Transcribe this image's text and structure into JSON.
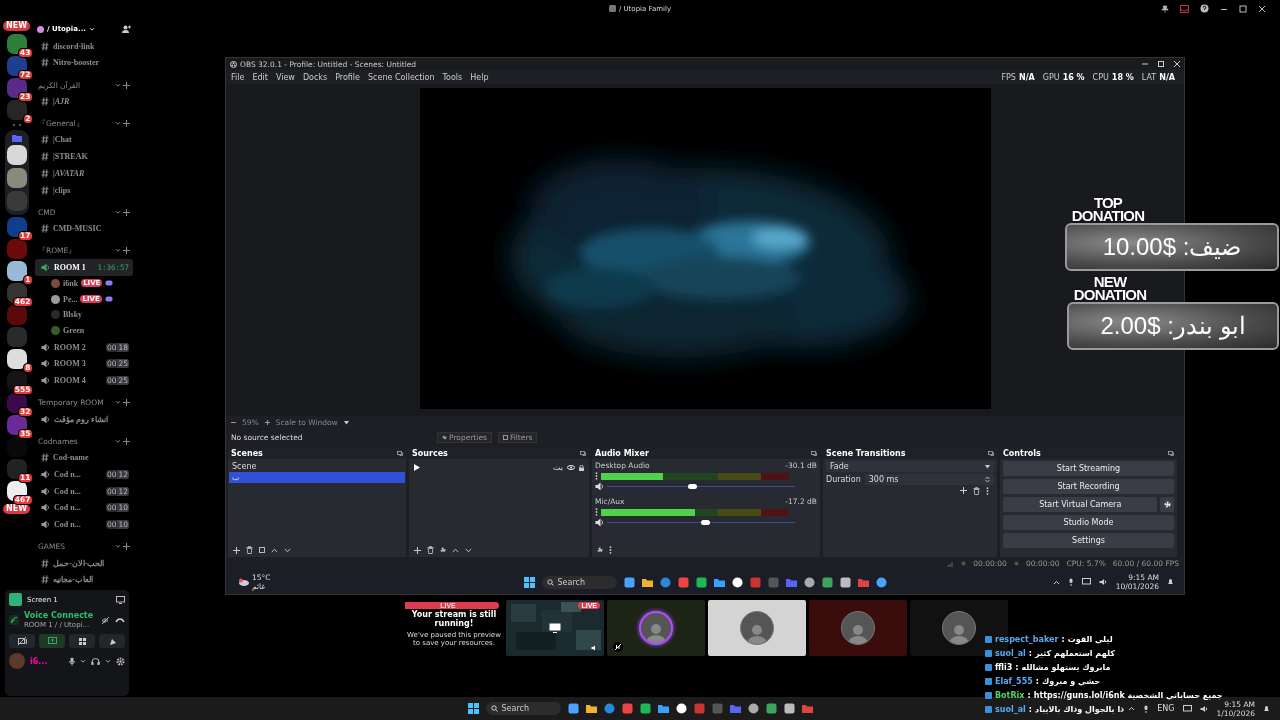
{
  "title_bar": {
    "title": "/ Utopia Family"
  },
  "servers": [
    {
      "kind": "new",
      "label": "NEW"
    },
    {
      "kind": "server",
      "color": "#2f7d3a",
      "badge": "43"
    },
    {
      "kind": "server",
      "color": "#1d3f8f",
      "badge": "72"
    },
    {
      "kind": "server",
      "color": "#5a2a8a",
      "badge": "23"
    },
    {
      "kind": "server",
      "color": "#262626",
      "badge": "2"
    },
    {
      "kind": "more"
    },
    {
      "kind": "folder",
      "children": [
        {
          "kind": "server",
          "color": "#d8d8d8"
        },
        {
          "kind": "server",
          "color": "#8a8a7a"
        },
        {
          "kind": "server",
          "color": "#3a3a3a"
        }
      ]
    },
    {
      "kind": "server",
      "color": "#0f3f8a",
      "badge": "17"
    },
    {
      "kind": "server",
      "color": "#6a0a0a"
    },
    {
      "kind": "server",
      "color": "#9ab8d8",
      "badge": "1"
    },
    {
      "kind": "server",
      "color": "#333333",
      "badge": "462"
    },
    {
      "kind": "server",
      "color": "#5a0808"
    },
    {
      "kind": "server",
      "color": "#2a2a2a"
    },
    {
      "kind": "server",
      "color": "#dddddd",
      "badge": "8"
    },
    {
      "kind": "server",
      "color": "#151515",
      "badge": "555"
    },
    {
      "kind": "server",
      "color": "#3a0a4a",
      "badge": "32"
    },
    {
      "kind": "server",
      "color": "#6a2a9a",
      "badge": "35"
    },
    {
      "kind": "server",
      "color": "#0a0a0a"
    },
    {
      "kind": "server",
      "color": "#222222",
      "badge": "11"
    },
    {
      "kind": "server",
      "color": "#eeeeee",
      "badge": "467"
    },
    {
      "kind": "new",
      "label": "NEW"
    }
  ],
  "guild": {
    "name": "/ Utopia..."
  },
  "sections": [
    {
      "items": [
        {
          "kind": "text",
          "name": "discord-link"
        },
        {
          "kind": "text",
          "name": "Nitro-booster"
        }
      ]
    },
    {
      "name": "القرآن الكريم",
      "items": [
        {
          "kind": "text",
          "name": "|AJR",
          "italic": true
        }
      ]
    },
    {
      "name": "『General』",
      "items": [
        {
          "kind": "text",
          "name": "|Chat"
        },
        {
          "kind": "text",
          "name": "|STREAK"
        },
        {
          "kind": "text",
          "name": "|AVATAR",
          "italic": true
        },
        {
          "kind": "text",
          "name": "|clips"
        }
      ]
    },
    {
      "name": "CMD",
      "items": [
        {
          "kind": "text",
          "name": "CMD-MUSIC"
        }
      ]
    },
    {
      "name": "『ROME』",
      "items": [
        {
          "kind": "voice",
          "name": "ROOM 1",
          "active": true,
          "timer": "1:36:57",
          "members": [
            {
              "name": "i6nk",
              "badge": "LIVE",
              "color": "#7a4a3a"
            },
            {
              "name": "Pe...",
              "badge": "LIVE",
              "color": "#9a9a9a"
            },
            {
              "name": "Blsky",
              "color": "#2a2a2a"
            },
            {
              "name": "Green",
              "color": "#3a5a2a"
            }
          ]
        },
        {
          "kind": "voice",
          "name": "ROOM 2",
          "active": false,
          "counts": [
            "00",
            "18"
          ]
        },
        {
          "kind": "voice",
          "name": "ROOM 3",
          "active": false,
          "counts": [
            "00",
            "25"
          ]
        },
        {
          "kind": "voice",
          "name": "ROOM 4",
          "active": false,
          "counts": [
            "00",
            "25"
          ]
        }
      ]
    },
    {
      "name": "Temporary ROOM",
      "items": [
        {
          "kind": "voice",
          "name": "انشاء روم مؤقت",
          "active": false
        }
      ]
    },
    {
      "name": "Codnames",
      "items": [
        {
          "kind": "text",
          "name": "Cod-name"
        },
        {
          "kind": "voice",
          "name": "Cod n...",
          "active": false,
          "counts": [
            "00",
            "12"
          ]
        },
        {
          "kind": "voice",
          "name": "Cod n...",
          "active": false,
          "counts": [
            "00",
            "12"
          ]
        },
        {
          "kind": "voice",
          "name": "Cod n...",
          "active": false,
          "counts": [
            "00",
            "10"
          ]
        },
        {
          "kind": "voice",
          "name": "Cod n...",
          "active": false,
          "counts": [
            "00",
            "10"
          ]
        }
      ]
    },
    {
      "name": "GAMES",
      "items": [
        {
          "kind": "text",
          "name": "الحب-الان-حمل"
        },
        {
          "kind": "text",
          "name": "العاب-مجانيه"
        }
      ]
    }
  ],
  "user_panel": {
    "stream": "Screen 1",
    "voice_status": "Voice Connecte",
    "voice_channel": "ROOM 1 / / Utopi...",
    "user": "i6..."
  },
  "obs": {
    "title": "OBS 32.0.1 - Profile: Untitled - Scenes: Untitled",
    "menu": [
      "File",
      "Edit",
      "View",
      "Docks",
      "Profile",
      "Scene Collection",
      "Tools",
      "Help"
    ],
    "stats": [
      {
        "label": "FPS",
        "value": "N/A"
      },
      {
        "label": "GPU",
        "value": "16 %"
      },
      {
        "label": "CPU",
        "value": "18 %"
      },
      {
        "label": "LAT",
        "value": "N/A"
      }
    ],
    "zoom": "59%",
    "scale": "Scale to Window",
    "source_status": "No source selected",
    "source_buttons": [
      "Properties",
      "Filters"
    ],
    "scenes": {
      "title": "Scenes",
      "items": [
        {
          "name": "Scene",
          "selected": false
        },
        {
          "name": "ب",
          "selected": true
        }
      ]
    },
    "sources": {
      "title": "Sources",
      "items": [
        {
          "name": "بث"
        }
      ]
    },
    "audio": {
      "title": "Audio Mixer",
      "channels": [
        {
          "name": "Desktop Audio",
          "reading": "-30.1 dB",
          "meter": {
            "level": 0.33
          },
          "fader": {
            "level": 0.45
          }
        },
        {
          "name": "Mic/Aux",
          "reading": "-17.2 dB",
          "meter": {
            "level": 0.5
          },
          "fader": {
            "level": 0.52
          }
        }
      ]
    },
    "transitions": {
      "title": "Scene Transitions",
      "type": "Fade",
      "duration_label": "Duration",
      "duration": "300 ms"
    },
    "controls": {
      "title": "Controls",
      "buttons": [
        "Start Streaming",
        "Start Recording",
        "Start Virtual Camera",
        "Studio Mode",
        "Settings"
      ]
    },
    "status": {
      "stream_time": "00:00:00",
      "record_time": "00:00:00",
      "cpu": "CPU: 5.7%",
      "fps": "60.00 / 60.00 FPS"
    },
    "taskbar": {
      "temp": "15°C",
      "condition": "غائم",
      "search": "Search",
      "time": "9:15 AM",
      "date": "10/01/2026"
    }
  },
  "donations": [
    {
      "title": "TOP DONATION",
      "text": "ضيف: $10.00"
    },
    {
      "title": "NEW DONATION",
      "text": "ابو بندر: $2.00"
    }
  ],
  "tiles": [
    {
      "kind": "notice",
      "title": "Your stream is still running!",
      "text": "We've paused this preview to save your resources.",
      "badge": "LIVE"
    },
    {
      "kind": "screen",
      "badge": "LIVE"
    },
    {
      "kind": "user",
      "color": "#1c2416",
      "ring": true,
      "muted": true
    },
    {
      "kind": "user",
      "color": "#d4d4d4",
      "ring": false,
      "muted": false
    },
    {
      "kind": "user",
      "color": "#3a0c0c",
      "ring": false,
      "muted": false
    },
    {
      "kind": "user",
      "color": "#111111",
      "ring": false,
      "muted": false
    }
  ],
  "chat": [
    {
      "user": "respect_baker",
      "color": "#5aa9f0",
      "sep": ":",
      "text": "ليلي القوت"
    },
    {
      "user": "suol_al",
      "color": "#5aa9f0",
      "sep": ":",
      "text": "كلهم استعملهم كثير"
    },
    {
      "user": "ffli3",
      "color": "#ffffff",
      "sep": ":",
      "text": "مابروك يستهلو مشالله"
    },
    {
      "user": "Elaf_555",
      "color": "#5aa9f0",
      "sep": ":",
      "text": "حشي و مبروك"
    },
    {
      "user": "BotRix",
      "color": "#4cd964",
      "sep": ":",
      "text": "جميع حساباتي الشخصية https://guns.lol/i6nk"
    },
    {
      "user": "suol_al",
      "color": "#5aa9f0",
      "sep": ":",
      "text": "ذا بالجوال وذاك بالايباد"
    }
  ],
  "taskbar": {
    "search": "Search",
    "language": "ENG",
    "time": "9:15 AM",
    "date": "1/10/2026"
  }
}
